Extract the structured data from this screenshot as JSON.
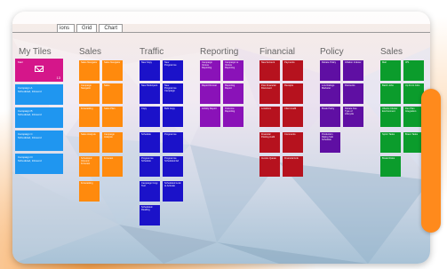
{
  "tabs": [
    "ions",
    "Grid",
    "Chart"
  ],
  "groups": [
    {
      "title": "My Tiles"
    },
    {
      "title": "Sales"
    },
    {
      "title": "Traffic"
    },
    {
      "title": "Reporting"
    },
    {
      "title": "Financial"
    },
    {
      "title": "Policy"
    },
    {
      "title": "Sales"
    }
  ],
  "my_tiles": [
    {
      "label": "Mail",
      "count": "13"
    },
    {
      "label": "Campaign A",
      "sub": "Scheduled, Inbound"
    },
    {
      "label": "Campaign B",
      "sub": "Scheduled, Inbound"
    },
    {
      "label": "Campaign C",
      "sub": "Scheduled, Inbound"
    },
    {
      "label": "Campaign D",
      "sub": "Scheduled, Inbound"
    }
  ],
  "sales": [
    "Sales Navigator",
    "Sales Navigator",
    "Campaign Navigator",
    "Sales",
    "Forecasting",
    "Sales Plan",
    "Sales Analysis",
    "Campaign Analysis",
    "Scheduled Inbound Forecast",
    "Forecast",
    "Forecasting"
  ],
  "traffic": [
    "New Copy",
    "New Programme",
    "New Participant",
    "New Programme Campaign",
    "Copy",
    "Bulk Copy",
    "Schedule",
    "Programme",
    "Programme Schedule",
    "Programme Scheduled Ad",
    "Campaign Copy Tool",
    "Scheduled Look to Activate",
    "Scheduled Reading"
  ],
  "reporting": [
    "Campaign Versus Reporting",
    "Campaign vs Versus Reporting",
    "Report Runner",
    "Reporting Report",
    "Activity Report",
    "Outcome Reporting"
  ],
  "financial": [
    "New Account",
    "Payments",
    "Post Financial Document",
    "Receipts",
    "Locations",
    "Client Audit",
    "Financial Posting Audit",
    "Comments",
    "Invoice Queue",
    "Financial Link"
  ],
  "policy": [
    "Rebate Policy",
    "Inflation Indexer",
    "Low Ratings Marketer",
    "Discounts",
    "Break Parity",
    "Rebate Fee Type of Lifecycle",
    "Production Rating Sub Schedule"
  ],
  "sales2": [
    "Mail",
    "IPS",
    "Batch Jobs",
    "Up Front Jobs",
    "Ubuntu Cluster Environment",
    "Dev Plan Integration",
    "Sprint Tasks",
    "Bravo Tasks",
    "Break Rules"
  ]
}
